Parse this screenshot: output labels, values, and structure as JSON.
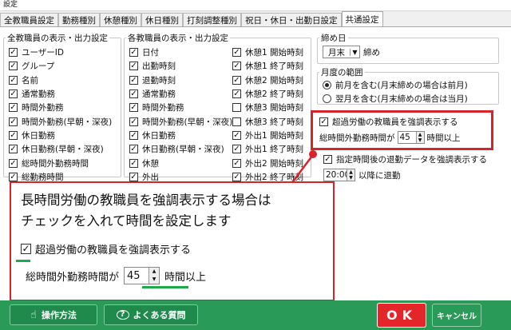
{
  "window": {
    "title": "設定"
  },
  "tabs": [
    "全教職員設定",
    "勤務種別",
    "休憩種別",
    "休日種別",
    "打刻調整種別",
    "祝日・休日・出勤日設定",
    "共通設定"
  ],
  "output_all": {
    "legend": "全教職員の表示・出力設定",
    "items": [
      "ユーザーID",
      "グループ",
      "名前",
      "通常勤務",
      "時間外勤務",
      "時間外勤務(早朝・深夜)",
      "休日勤務",
      "休日勤務(早朝・深夜)",
      "総時間外勤務時間",
      "総勤務時間"
    ]
  },
  "output_each": {
    "legend": "各教職員の表示・出力設定",
    "items": [
      "日付",
      "出勤時刻",
      "退勤時刻",
      "通常勤務",
      "時間外勤務",
      "時間外勤務(早朝・深夜)",
      "休日勤務",
      "休日勤務(早朝・深夜)",
      "休憩",
      "外出"
    ]
  },
  "output_rest": {
    "items": [
      {
        "label": "休憩1 開始時刻",
        "checked": true
      },
      {
        "label": "休憩1 終了時刻",
        "checked": true
      },
      {
        "label": "休憩2 開始時刻",
        "checked": true
      },
      {
        "label": "休憩2 終了時刻",
        "checked": true
      },
      {
        "label": "休憩3 開始時刻",
        "checked": false
      },
      {
        "label": "休憩3 終了時刻",
        "checked": false
      },
      {
        "label": "外出1 開始時刻",
        "checked": true
      },
      {
        "label": "外出1 終了時刻",
        "checked": true
      },
      {
        "label": "外出2 開始時刻",
        "checked": true
      },
      {
        "label": "外出2 終了時刻",
        "checked": true
      }
    ]
  },
  "closing": {
    "legend": "締め日",
    "value": "月末",
    "suffix": "締め"
  },
  "year_range": {
    "legend": "月度の範囲",
    "options": [
      {
        "label": "前月を含む(月末締めの場合は前月)",
        "selected": true
      },
      {
        "label": "翌月を含む(月末締めの場合は当月)",
        "selected": false
      }
    ]
  },
  "overtime": {
    "label": "超過労働の教職員を強調表示する",
    "hours_label": "総時間外勤務時間が",
    "hours_value": "45",
    "hours_suffix": "時間以上"
  },
  "late_highlight": {
    "label": "指定時間後の退勤データを強調表示する",
    "time_value": "20:00",
    "suffix": "以降に退勤"
  },
  "callout": {
    "line1": "長時間労働の教職員を強調表示する場合は",
    "line2": "チェックを入れて時間を設定します",
    "checkbox_label": "超過労働の教職員を強調表示する",
    "hours_label": "総時間外勤務時間が",
    "hours_value": "45",
    "hours_suffix": "時間以上"
  },
  "footer": {
    "howto": "操作方法",
    "faq": "よくある質問",
    "ok": "OK",
    "cancel": "キャンセル"
  },
  "colors": {
    "highlight_red": "#d9232a",
    "footer_green": "#2a9a58",
    "ok_red": "#e4262b",
    "underline_green": "#1faa4a"
  }
}
